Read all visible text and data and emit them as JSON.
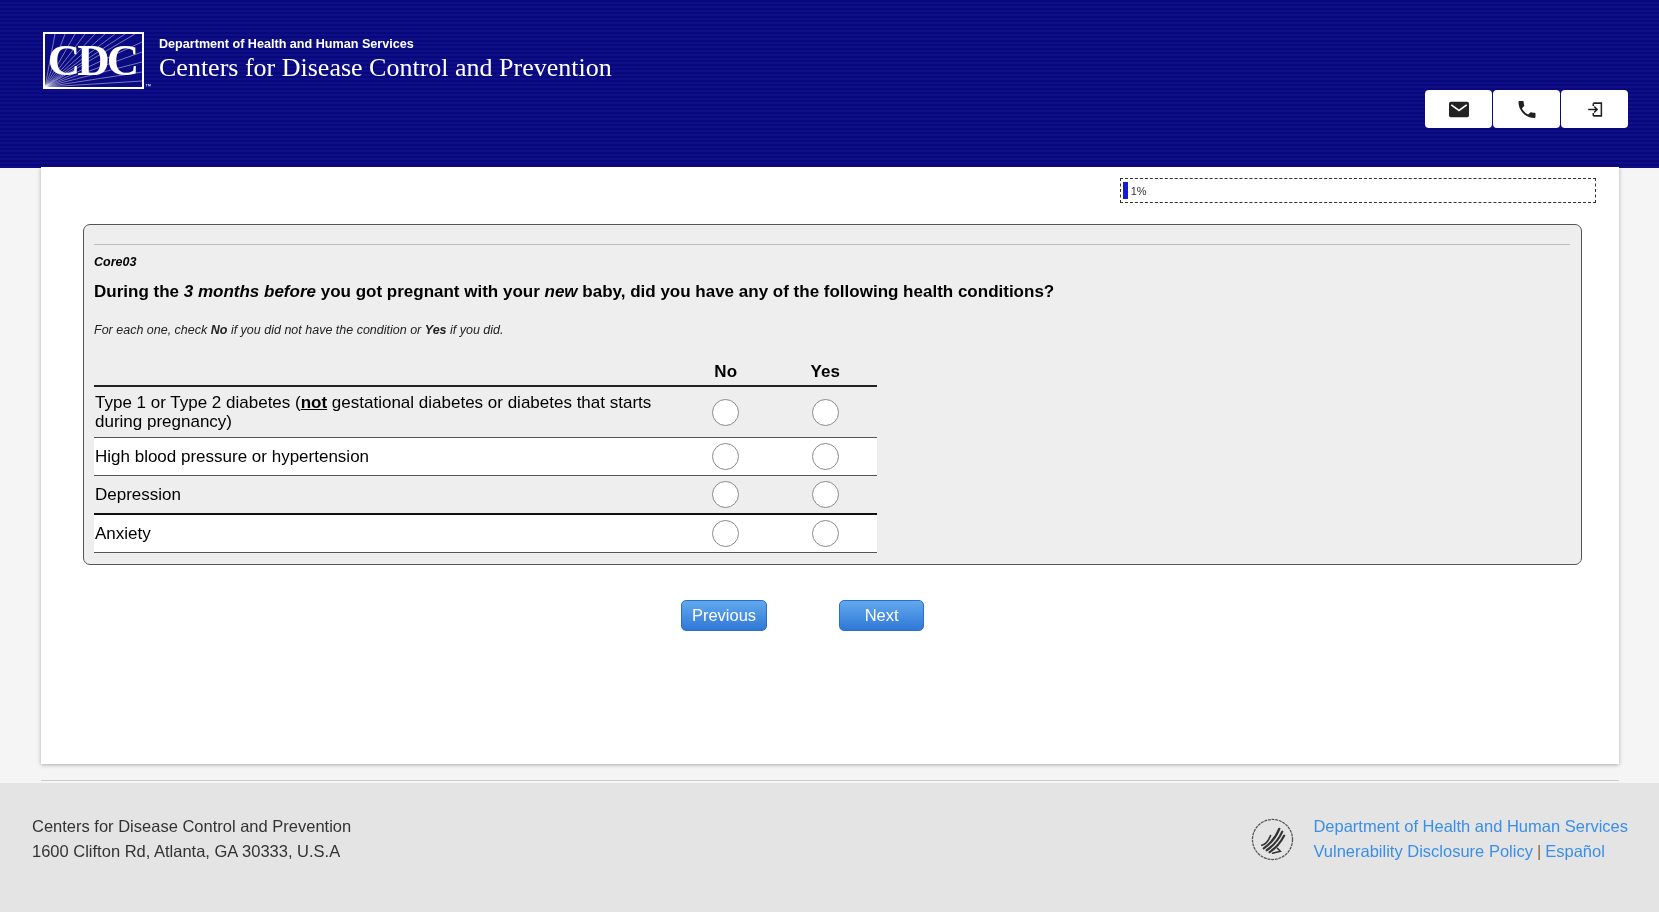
{
  "header": {
    "logo_text": "CDC",
    "logo_mark": "™",
    "department": "Department of Health and Human Services",
    "agency": "Centers for Disease Control and Prevention",
    "actions": [
      {
        "kind": "mail"
      },
      {
        "kind": "phone"
      },
      {
        "kind": "sign_in"
      }
    ]
  },
  "progress": {
    "level": 0.01,
    "label": "1%"
  },
  "question": {
    "code": "Core03",
    "text": "During the *3 months before* you got pregnant with your *new* baby, did you have any of the following health conditions?",
    "instruction": "For each one, check **No** if you did not have the condition or **Yes** if you did.",
    "columns": [
      "No",
      "Yes"
    ],
    "rows": [
      {
        "label": "Type 1 or Type 2 diabetes (**not** gestational diabetes or diabetes that starts during pregnancy)",
        "answers": [
          {
            "selected": false
          },
          {
            "selected": false
          }
        ]
      },
      {
        "label": "High blood pressure or hypertension",
        "answers": [
          {
            "selected": false
          },
          {
            "selected": false
          }
        ]
      },
      {
        "label": "Depression",
        "answers": [
          {
            "selected": false
          },
          {
            "selected": false
          }
        ]
      },
      {
        "label": "Anxiety",
        "answers": [
          {
            "selected": false
          },
          {
            "selected": false
          }
        ]
      }
    ]
  },
  "buttons": [
    "Previous",
    "Next"
  ],
  "footer": {
    "organization": "Centers for Disease Control and Prevention",
    "address": "1600 Clifton Rd, Atlanta, GA 30333, U.S.A",
    "link_rows": [
      {
        "links": [
          "Department of Health and Human Services"
        ]
      },
      {
        "links": [
          "Vulnerability Disclosure Policy",
          "Español"
        ]
      }
    ],
    "separator": "|"
  }
}
